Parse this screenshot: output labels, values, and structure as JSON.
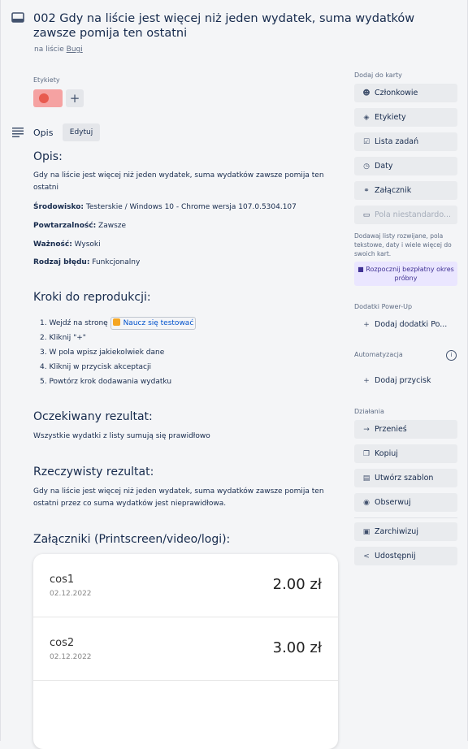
{
  "card": {
    "title": "002 Gdy na liście jest więcej niż jeden wydatek, suma wydatków zawsze pomija ten ostatni",
    "in_list_prefix": "na liście",
    "list_name": "Bugi"
  },
  "labels": {
    "header": "Etykiety",
    "add": "+",
    "color": "#e85a4f"
  },
  "description": {
    "header": "Opis",
    "edit": "Edytuj",
    "heading": "Opis:",
    "text": "Gdy na liście jest więcej niż jeden wydatek, suma wydatków zawsze pomija ten ostatni",
    "fields": [
      {
        "key": "Środowisko:",
        "value": " Testerskie / Windows 10 - Chrome wersja 107.0.5304.107"
      },
      {
        "key": "Powtarzalność:",
        "value": " Zawsze"
      },
      {
        "key": "Ważność:",
        "value": " Wysoki"
      },
      {
        "key": "Rodzaj błędu:",
        "value": " Funkcjonalny"
      }
    ],
    "steps_heading": "Kroki do reprodukcji:",
    "steps": [
      {
        "text": "1. Wejdź na stronę",
        "link": "Naucz się testować"
      },
      {
        "text": "2. Kliknij \"+\""
      },
      {
        "text": "3. W pola wpisz jakiekolwiek dane"
      },
      {
        "text": "4. Kliknij w przycisk akceptacji"
      },
      {
        "text": "5. Powtórz krok dodawania wydatku"
      }
    ],
    "expected_heading": "Oczekiwany rezultat:",
    "expected_text": "Wszystkie wydatki z listy sumują się prawidłowo",
    "actual_heading": "Rzeczywisty rezultat:",
    "actual_text": "Gdy na liście jest więcej niż jeden wydatek, suma wydatków zawsze pomija ten ostatni przez co suma wydatków jest nieprawidłowa.",
    "attachments_heading": "Załączniki (Printscreen/video/logi):"
  },
  "screenshot_expenses": [
    {
      "name": "cos1",
      "date": "02.12.2022",
      "amount": "2.00 zł"
    },
    {
      "name": "cos2",
      "date": "02.12.2022",
      "amount": "3.00 zł"
    }
  ],
  "sidebar": {
    "add_to_card": "Dodaj do karty",
    "buttons": [
      {
        "label": "Członkowie",
        "icon": "person-icon"
      },
      {
        "label": "Etykiety",
        "icon": "tag-icon"
      },
      {
        "label": "Lista zadań",
        "icon": "checklist-icon"
      },
      {
        "label": "Daty",
        "icon": "clock-icon"
      },
      {
        "label": "Załącznik",
        "icon": "paperclip-icon"
      },
      {
        "label": "Pola niestandardo...",
        "icon": "fields-icon"
      }
    ],
    "custom_fields_note": "Dodawaj listy rozwijane, pola tekstowe, daty i wiele więcej do swoich kart.",
    "trial": "Rozpocznij bezpłatny okres próbny",
    "powerups_header": "Dodatki Power-Up",
    "add_powerups": "Dodaj dodatki Po...",
    "automation_header": "Automatyzacja",
    "add_button": "Dodaj przycisk",
    "actions_header": "Działania",
    "actions": [
      {
        "label": "Przenieś",
        "icon": "arrow-right-icon"
      },
      {
        "label": "Kopiuj",
        "icon": "copy-icon"
      },
      {
        "label": "Utwórz szablon",
        "icon": "template-icon"
      },
      {
        "label": "Obserwuj",
        "icon": "eye-icon"
      },
      {
        "label": "Zarchiwizuj",
        "icon": "archive-icon"
      },
      {
        "label": "Udostępnij",
        "icon": "share-icon"
      }
    ]
  }
}
